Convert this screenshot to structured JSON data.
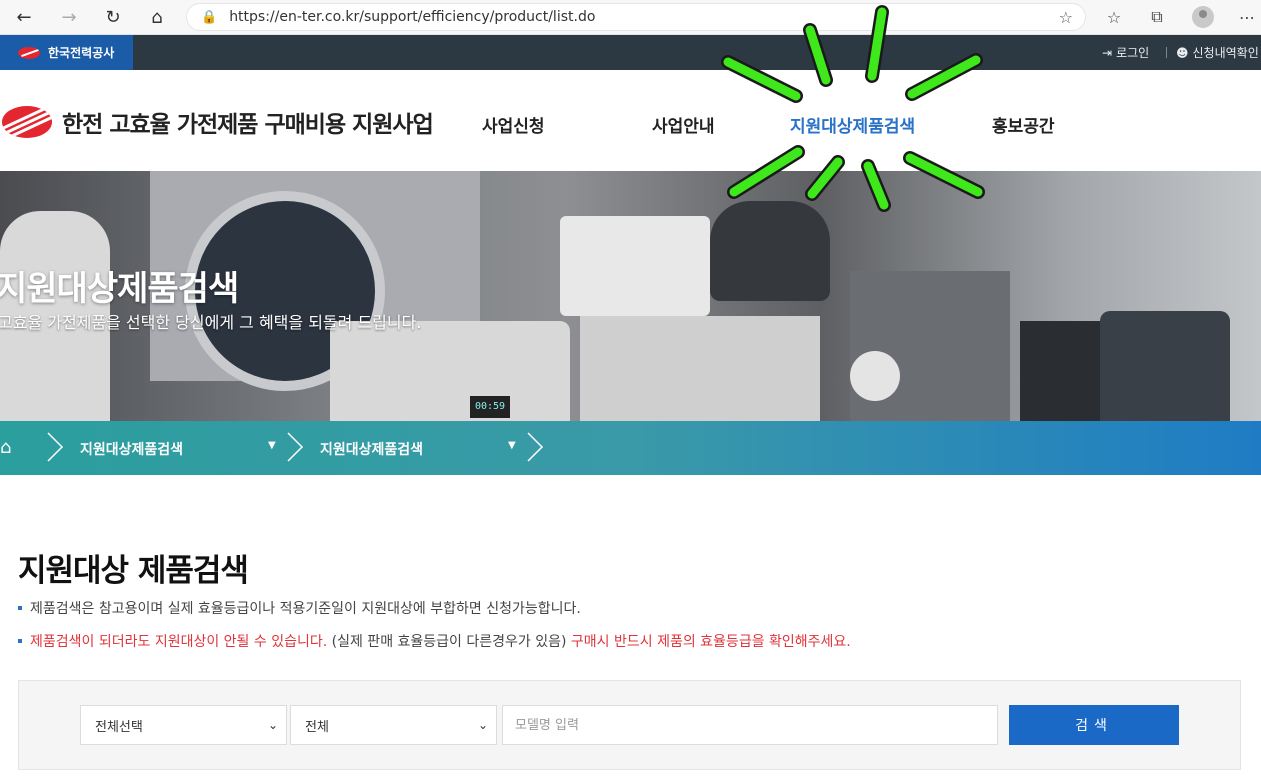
{
  "browser": {
    "url": "https://en-ter.co.kr/support/efficiency/product/list.do"
  },
  "topbar": {
    "org_name": "한국전력공사",
    "login_label": "로그인",
    "history_label": "신청내역확인"
  },
  "header": {
    "site_title": "한전 고효율 가전제품 구매비용 지원사업",
    "nav": [
      {
        "label": "사업신청"
      },
      {
        "label": "사업안내"
      },
      {
        "label": "지원대상제품검색",
        "active": true
      },
      {
        "label": "홍보공간"
      }
    ]
  },
  "hero": {
    "title": "지원대상제품검색",
    "subtitle": "고효율 가전제품을 선택한 당신에게 그 혜택을 되돌려 드립니다.",
    "timer_display": "00:59"
  },
  "breadcrumb": {
    "items": [
      {
        "label": "지원대상제품검색"
      },
      {
        "label": "지원대상제품검색"
      }
    ]
  },
  "main": {
    "title": "지원대상 제품검색",
    "note1": "제품검색은 참고용이며 실제 효율등급이나 적용기준일이 지원대상에 부합하면 신청가능합니다.",
    "note2_red_a": "제품검색이 되더라도 지원대상이 안될 수 있습니다.",
    "note2_plain": " (실제 판매 효율등급이 다른경우가 있음) ",
    "note2_red_b": "구매시 반드시 제품의 효율등급을 확인해주세요."
  },
  "search": {
    "category_select": "전체선택",
    "sub_select": "전체",
    "model_placeholder": "모델명 입력",
    "button_label": "검색"
  },
  "colors": {
    "accent_blue": "#1a69c7",
    "active_nav": "#2a72c8",
    "notice_red": "#e0343b",
    "burst_green": "#3ee81a"
  }
}
